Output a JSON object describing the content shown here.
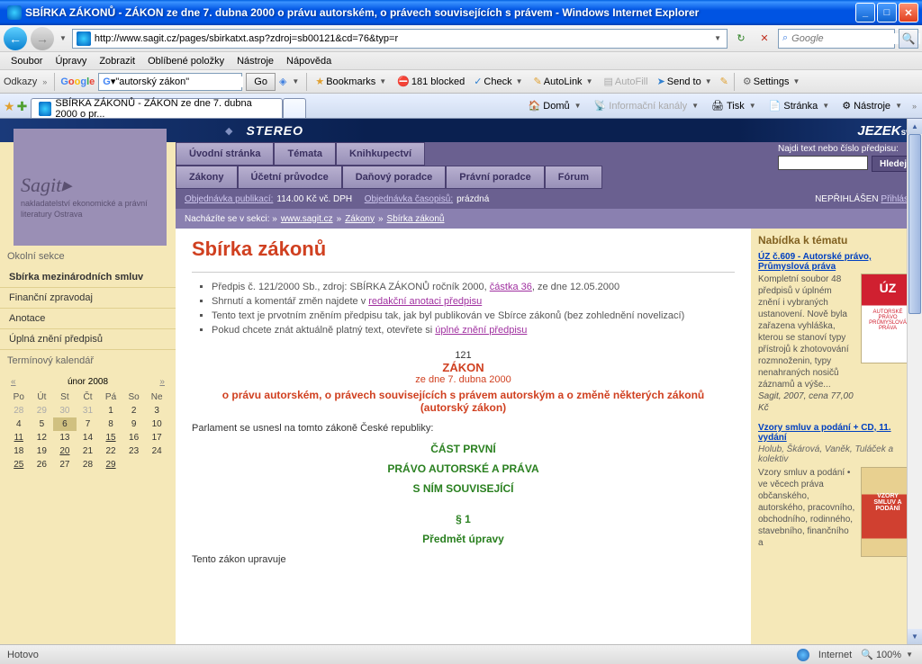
{
  "window": {
    "title": "SBÍRKA ZÁKONŮ - ZÁKON ze dne 7. dubna 2000 o právu autorském, o právech souvisejících s právem  - Windows Internet Explorer"
  },
  "nav": {
    "url": "http://www.sagit.cz/pages/sbirkatxt.asp?zdroj=sb00121&cd=76&typ=r",
    "search_placeholder": "Google"
  },
  "menu": {
    "soubor": "Soubor",
    "upravy": "Úpravy",
    "zobrazit": "Zobrazit",
    "oblibene": "Oblíbené položky",
    "nastroje": "Nástroje",
    "napoveda": "Nápověda"
  },
  "googlebar": {
    "odkazy": "Odkazy",
    "query": "\"autorský zákon\"",
    "go": "Go",
    "bookmarks": "Bookmarks",
    "blocked": "181 blocked",
    "check": "Check",
    "autolink": "AutoLink",
    "autofill": "AutoFill",
    "sendto": "Send to",
    "settings": "Settings"
  },
  "tab": {
    "title": "SBÍRKA ZÁKONŮ - ZÁKON ze dne 7. dubna 2000 o pr..."
  },
  "toolbar": {
    "domu": "Domů",
    "kanaly": "Informační kanály",
    "tisk": "Tisk",
    "stranka": "Stránka",
    "nastroje": "Nástroje"
  },
  "banner": {
    "stereo": "STEREO",
    "jezek": "JEZEK",
    "sw": "sw"
  },
  "sagit": {
    "name": "Sagit",
    "sub": "nakladatelství ekonomické a právní literatury Ostrava"
  },
  "ptabs": {
    "uvod": "Úvodní stránka",
    "temata": "Témata",
    "knih": "Knihkupectví",
    "zakony": "Zákony",
    "ucetni": "Účetní průvodce",
    "danovy": "Daňový poradce",
    "pravni": "Právní poradce",
    "forum": "Fórum"
  },
  "search": {
    "label": "Najdi text nebo číslo předpisu:",
    "btn": "Hledej"
  },
  "orderbar": {
    "obj_pub": "Objednávka publikací:",
    "price": "114.00 Kč vč. DPH",
    "obj_cas": "Objednávka časopisů:",
    "empty": "prázdná",
    "nopr": "NEPŘIHLÁŠEN",
    "login": "Přihlásit"
  },
  "bc": {
    "label": "Nacházíte se v sekci: »",
    "l1": "www.sagit.cz",
    "l2": "Zákony",
    "l3": "Sbírka zákonů"
  },
  "sidebar": {
    "hdr": "Okolní sekce",
    "items": [
      "Sbírka mezinárodních smluv",
      "Finanční zpravodaj",
      "Anotace",
      "Úplná znění předpisů"
    ],
    "cal_hdr": "Termínový kalendář"
  },
  "calendar": {
    "month": "únor 2008",
    "days": [
      "Po",
      "Út",
      "St",
      "Čt",
      "Pá",
      "So",
      "Ne"
    ]
  },
  "article": {
    "h1": "Sbírka zákonů",
    "b1a": "Předpis č. 121/2000 Sb., zdroj: SBÍRKA ZÁKONŮ ročník 2000, ",
    "b1link": "částka 36",
    "b1b": ", ze dne 12.05.2000",
    "b2a": "Shrnutí a komentář změn najdete v ",
    "b2link": "redakční anotaci předpisu",
    "b3": "Tento text je prvotním zněním předpisu tak, jak byl publikován ve Sbírce zákonů (bez zohlednění novelizací)",
    "b4a": "Pokud chcete znát aktuálně platný text, otevřete si ",
    "b4link": "úplné znění předpisu",
    "num": "121",
    "zakon": "ZÁKON",
    "date": "ze dne 7. dubna 2000",
    "subtitle": "o právu autorském, o právech souvisejících s právem autorským a o změně některých zákonů (autorský zákon)",
    "parl": "Parlament se usnesl na tomto zákoně České republiky:",
    "s1": "ČÁST PRVNÍ",
    "s2": "PRÁVO AUTORSKÉ A PRÁVA",
    "s3": "S NÍM SOUVISEJÍCÍ",
    "s4": "§ 1",
    "s5": "Předmět úpravy",
    "foot": "Tento zákon upravuje"
  },
  "right": {
    "hdr": "Nabídka k tématu",
    "o1_title": "ÚZ č.609 - Autorské právo, Průmyslová práva",
    "o1_text": "Kompletní soubor 48 předpisů v úplném znění i vybraných ustanovení. Nově byla zařazena vyhláška, kterou se stanoví typy přístrojů k zhotovování rozmnoženin, typy nenahraných nosičů záznamů a výše...",
    "o1_price": "Sagit, 2007, cena 77,00 Kč",
    "o2_title": "Vzory smluv a podání + CD, 11. vydání",
    "o2_auth": "Holub, Škárová, Vaněk, Tuláček a kolektiv",
    "o2_text": "Vzory smluv a podání • ve věcech práva občanského, autorského, pracovního, obchodního, rodinného, stavebního, finančního a ",
    "uz": "ÚZ",
    "uz2": "AUTORSKÉ PRÁVO PRŮMYSLOVÁ PRÁVA",
    "vs": "VZORY SMLUV A PODÁNÍ"
  },
  "status": {
    "hotovo": "Hotovo",
    "internet": "Internet",
    "zoom": "100%"
  }
}
